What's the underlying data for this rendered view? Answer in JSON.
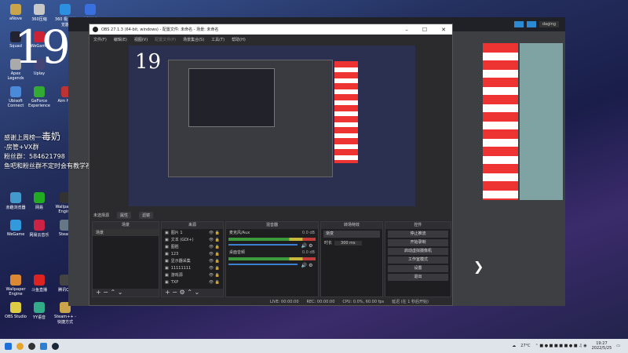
{
  "desktop": {
    "icons": [
      "aNove",
      "360压缩",
      "360 极速浏览器",
      "电脑管家",
      "Squad",
      "WeGame",
      "Apex Legends",
      "Uplay",
      "Ubisoft Connect",
      "GeForce Experience",
      "Aim Hero",
      "赤趣浏览器",
      "网易",
      "Wallpaper Engine",
      "WeGame",
      "网易云音乐",
      "Steam",
      "Wallpaper Engine",
      "斗鱼直播",
      "腾讯QQ",
      "OBS Studio",
      "YY语音",
      "Steam++ - 快捷方式"
    ],
    "big_number": "19",
    "overlay": {
      "line1": "感谢上周榜一",
      "line1_big": "毒奶",
      "line2": "-房管+VX群",
      "line3": "粉丝群：584621798",
      "line4": "鱼吧和粉丝群不定时会有教学视频和天赋"
    }
  },
  "bg_window": {
    "user": "daging"
  },
  "obs": {
    "title": "OBS 27.1.3 (64-bit, windows) - 配置文件: 未命名 - 场景: 未命名",
    "controls": [
      "–",
      "☐",
      "✕"
    ],
    "menu": [
      "文件(F)",
      "编辑(E)",
      "视图(V)",
      "配置文件(P)",
      "场景集合(S)",
      "工具(T)",
      "帮助(H)"
    ],
    "source_bar": {
      "label": "未选择源",
      "properties": "属性",
      "filters": "滤镜"
    },
    "scenes": {
      "header": "场景",
      "items": [
        "场景"
      ]
    },
    "sources": {
      "header": "来源",
      "items": [
        "图片 1",
        "文本 (GDI+)",
        "图胜",
        "123",
        "显示器采集",
        "11111111",
        "游戏源",
        "TXP"
      ]
    },
    "mixer": {
      "header": "混音器",
      "channels": [
        {
          "name": "麦克风/Aux",
          "db": "0.0 dB"
        },
        {
          "name": "桌面音频",
          "db": "0.0 dB"
        }
      ]
    },
    "transitions": {
      "header": "转场特效",
      "type": "渐变",
      "duration_label": "时长",
      "duration": "300 ms"
    },
    "controls_dock": {
      "header": "控件",
      "buttons": [
        "停止推流",
        "开始录制",
        "启动虚拟摄像机",
        "工作室模式",
        "设置",
        "退出"
      ]
    },
    "status": {
      "live": "LIVE: 00:00:00",
      "rec": "REC: 00:00:00",
      "cpu": "CPU: 0.0%, 60.00 fps",
      "delay": "延迟 (在 1 秒后开始)"
    }
  },
  "taskbar": {
    "weather": "27°C",
    "time": "19:27",
    "date": "2022/5/25"
  },
  "colors": {
    "accent": "#3a7fd0",
    "stripe_red": "#e33333"
  }
}
